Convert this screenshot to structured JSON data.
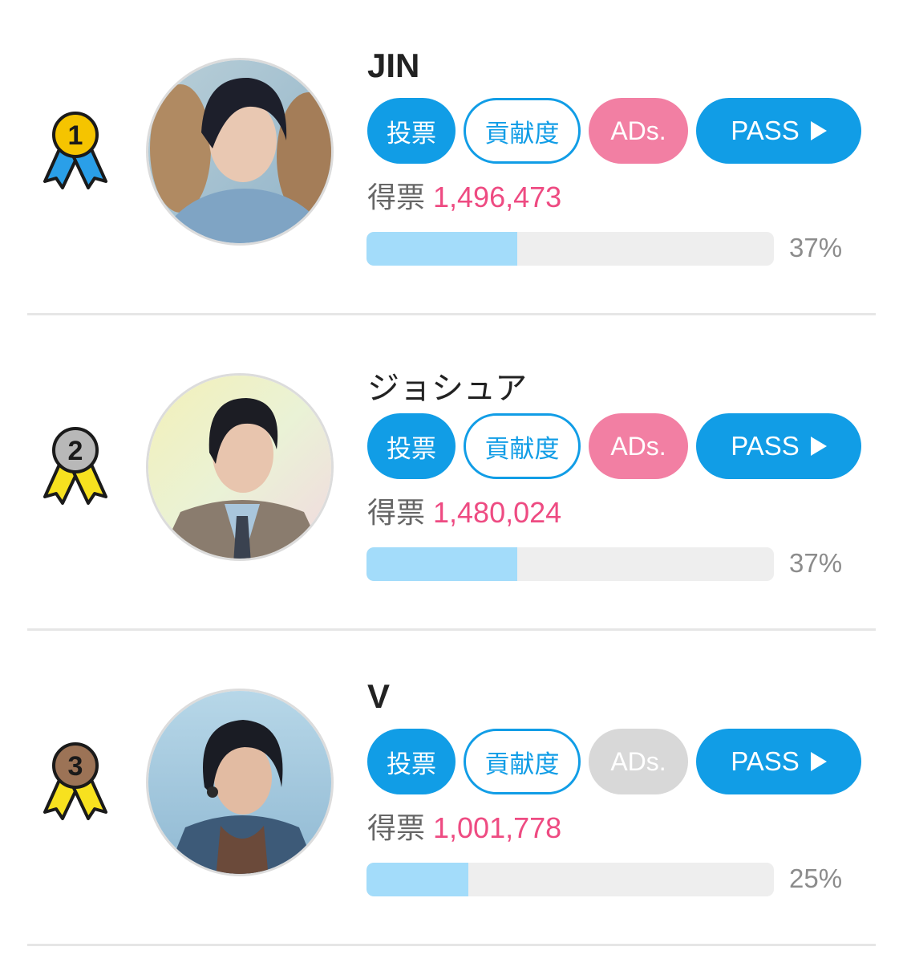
{
  "ranking": {
    "entries": [
      {
        "rank": "1",
        "name": "JIN",
        "buttons": {
          "vote": "投票",
          "contribution": "貢献度",
          "ads": "ADs.",
          "pass": "PASS"
        },
        "votes_label": "得票",
        "votes": "1,496,473",
        "percent_label": "37%",
        "percent": 37,
        "medal_color": "#f5c400",
        "ribbon_color": "#2a9fe8",
        "ads_active": true
      },
      {
        "rank": "2",
        "name": "ジョシュア",
        "buttons": {
          "vote": "投票",
          "contribution": "貢献度",
          "ads": "ADs.",
          "pass": "PASS"
        },
        "votes_label": "得票",
        "votes": "1,480,024",
        "percent_label": "37%",
        "percent": 37,
        "medal_color": "#b8b8b8",
        "ribbon_color": "#f7e11f",
        "ads_active": true
      },
      {
        "rank": "3",
        "name": "V",
        "buttons": {
          "vote": "投票",
          "contribution": "貢献度",
          "ads": "ADs.",
          "pass": "PASS"
        },
        "votes_label": "得票",
        "votes": "1,001,778",
        "percent_label": "25%",
        "percent": 25,
        "medal_color": "#9c7356",
        "ribbon_color": "#f7e11f",
        "ads_active": false
      }
    ]
  },
  "colors": {
    "primary_blue": "#119de6",
    "ads_pink": "#f27fa3",
    "ads_disabled": "#d8d8d8",
    "votes_pink": "#ee4b82",
    "bar_fill": "#a3dcfa",
    "bar_track": "#eeeeee"
  }
}
